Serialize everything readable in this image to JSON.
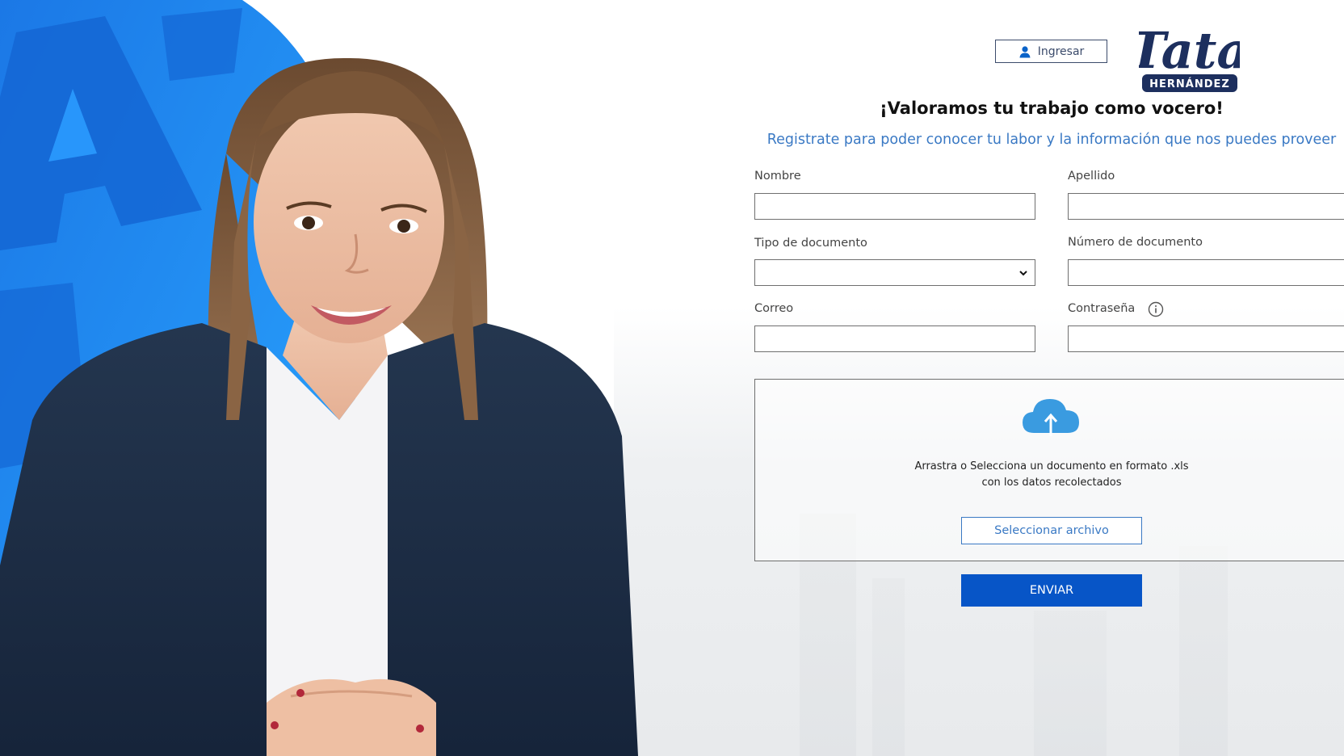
{
  "header": {
    "login_label": "Ingresar",
    "logo": {
      "script_text": "Tata",
      "badge_text": "HERNÁNDEZ"
    }
  },
  "intro": {
    "title": "¡Valoramos tu trabajo como vocero!",
    "subtitle": "Registrate para poder conocer tu labor y la información que nos puedes proveer"
  },
  "form": {
    "first_name_label": "Nombre",
    "first_name_value": "",
    "last_name_label": "Apellido",
    "last_name_value": "",
    "doc_type_label": "Tipo de documento",
    "doc_type_selected": "",
    "doc_number_label": "Número de documento",
    "doc_number_value": "",
    "email_label": "Correo",
    "email_value": "",
    "password_label": "Contraseña",
    "password_value": ""
  },
  "upload": {
    "instructions": "Arrastra o Selecciona un documento en formato .xls con los datos recolectados",
    "select_file_label": "Seleccionar archivo"
  },
  "submit_label": "ENVIAR",
  "colors": {
    "brand_blue": "#0755c7",
    "link_blue": "#3a79c4",
    "logo_navy": "#1d2f5e",
    "cloud_blue": "#3a9be0",
    "hero_blue": "#1a8cf0"
  },
  "icons": {
    "login": "user-icon",
    "password_help": "info-icon",
    "upload": "cloud-upload-icon",
    "select": "chevron-down-icon"
  }
}
